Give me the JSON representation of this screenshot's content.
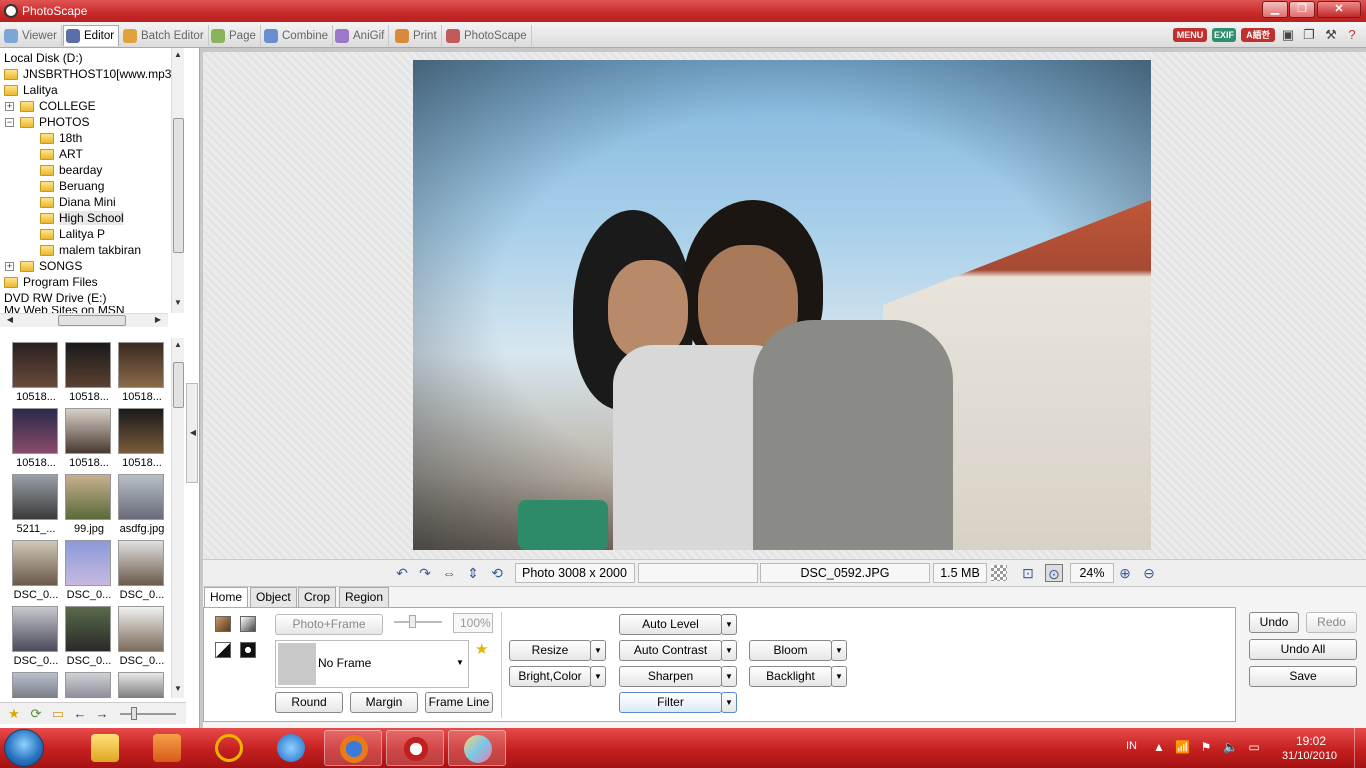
{
  "window": {
    "title": "PhotoScape",
    "min": "▁",
    "max": "❐",
    "close": "✕"
  },
  "tabs": [
    {
      "label": "Viewer",
      "icon": "viewer-icon"
    },
    {
      "label": "Editor",
      "icon": "editor-icon"
    },
    {
      "label": "Batch Editor",
      "icon": "batch-editor-icon"
    },
    {
      "label": "Page",
      "icon": "page-icon"
    },
    {
      "label": "Combine",
      "icon": "combine-icon"
    },
    {
      "label": "AniGif",
      "icon": "anigif-icon"
    },
    {
      "label": "Print",
      "icon": "print-icon"
    },
    {
      "label": "PhotoScape",
      "icon": "photoscape-icon"
    }
  ],
  "toolbar_right": {
    "menu": "MENU",
    "exif": "EXIF",
    "lang": "A語한"
  },
  "tree": {
    "items": [
      {
        "label": "Local Disk (D:)",
        "indent": 0
      },
      {
        "label": "JNSBRTHOST10[www.mp3",
        "indent": 0
      },
      {
        "label": "Lalitya",
        "indent": 0
      },
      {
        "label": "COLLEGE",
        "indent": 1
      },
      {
        "label": "PHOTOS",
        "indent": 1
      },
      {
        "label": "18th",
        "indent": 2
      },
      {
        "label": "ART",
        "indent": 2
      },
      {
        "label": "bearday",
        "indent": 2
      },
      {
        "label": "Beruang",
        "indent": 2
      },
      {
        "label": "Diana Mini",
        "indent": 2
      },
      {
        "label": "High School",
        "indent": 2
      },
      {
        "label": "Lalitya P",
        "indent": 2
      },
      {
        "label": "malem takbiran",
        "indent": 2
      },
      {
        "label": "SONGS",
        "indent": 1
      },
      {
        "label": "Program Files",
        "indent": 0
      },
      {
        "label": "DVD RW Drive (E:)",
        "indent": 0
      },
      {
        "label": "My Web Sites on MSN",
        "indent": 0
      }
    ]
  },
  "thumbnails": [
    {
      "label": "10518..."
    },
    {
      "label": "10518..."
    },
    {
      "label": "10518..."
    },
    {
      "label": "10518..."
    },
    {
      "label": "10518..."
    },
    {
      "label": "10518..."
    },
    {
      "label": "5211_..."
    },
    {
      "label": "99.jpg"
    },
    {
      "label": "asdfg.jpg"
    },
    {
      "label": "DSC_0..."
    },
    {
      "label": "DSC_0..."
    },
    {
      "label": "DSC_0..."
    },
    {
      "label": "DSC_0..."
    },
    {
      "label": "DSC_0..."
    },
    {
      "label": "DSC_0..."
    },
    {
      "label": ""
    },
    {
      "label": ""
    },
    {
      "label": ""
    }
  ],
  "status": {
    "dimensions": "Photo 3008 x 2000",
    "blank": "",
    "filename": "DSC_0592.JPG",
    "size": "1.5 MB",
    "zoom": "24%"
  },
  "editor_tabs": [
    "Home",
    "Object",
    "Crop",
    "Region"
  ],
  "home": {
    "photo_frame": "Photo+Frame",
    "opacity": "100%",
    "frame_value": "No Frame",
    "round": "Round",
    "margin": "Margin",
    "frame_line": "Frame Line",
    "resize": "Resize",
    "bright_color": "Bright,Color",
    "auto_level": "Auto Level",
    "auto_contrast": "Auto Contrast",
    "sharpen": "Sharpen",
    "filter": "Filter",
    "bloom": "Bloom",
    "backlight": "Backlight",
    "dropdown_arrow": "▼"
  },
  "history": {
    "undo": "Undo",
    "redo": "Redo",
    "undo_all": "Undo All",
    "save": "Save"
  },
  "taskbar": {
    "lang": "IN",
    "time": "19:02",
    "date": "31/10/2010"
  }
}
